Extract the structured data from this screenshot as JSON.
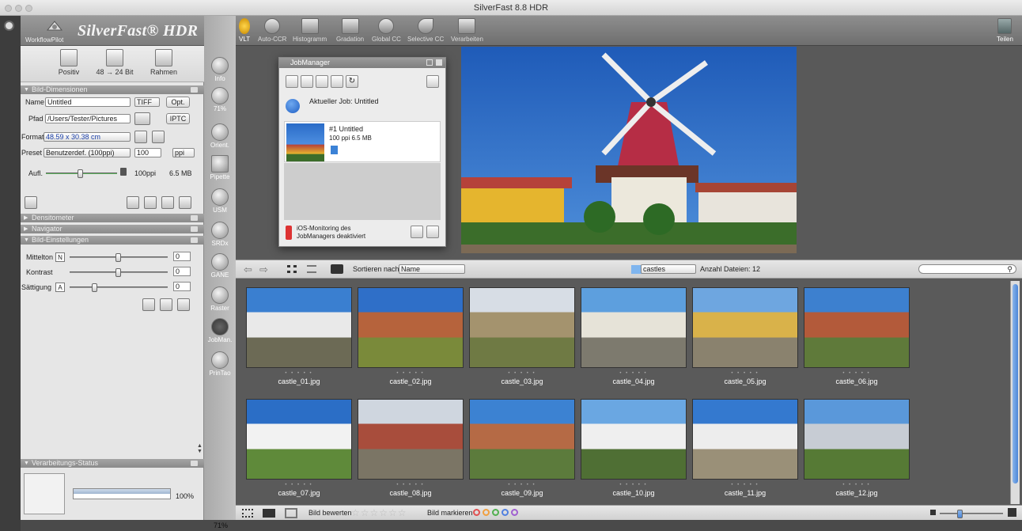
{
  "window": {
    "title": "SilverFast 8.8 HDR"
  },
  "logo": {
    "brand": "SilverFast® HDR",
    "workflowpilot": "WorkflowPilot"
  },
  "modes": [
    {
      "label": "Positiv"
    },
    {
      "label": "48 → 24 Bit"
    },
    {
      "label": "Rahmen"
    }
  ],
  "bild_dimensionen": {
    "header": "Bild-Dimensionen",
    "name_label": "Name",
    "name_value": "Untitled",
    "format_popup": "TIFF",
    "opt_button": "Opt.",
    "pfad_label": "Pfad",
    "pfad_value": "/Users/Tester/Pictures",
    "iptc_button": "IPTC",
    "format_label": "Format",
    "format_value": "48.59 x 30.38 cm",
    "preset_label": "Preset",
    "preset_value": "Benutzerdef. (100ppi)",
    "ppi_value": "100",
    "ppi_unit": "ppi",
    "aufl_label": "Aufl.",
    "aufl_value": "100ppi",
    "size_value": "6.5 MB"
  },
  "collapsed_sections": [
    "Densitometer",
    "Navigator"
  ],
  "bild_einstellungen": {
    "header": "Bild-Einstellungen",
    "rows": [
      {
        "label": "Mittelton",
        "letter": "N",
        "value": "0"
      },
      {
        "label": "Kontrast",
        "letter": "",
        "value": "0"
      },
      {
        "label": "Sättigung",
        "letter": "A",
        "value": "0"
      }
    ]
  },
  "verarbeitung": {
    "header": "Verarbeitungs-Status",
    "progress": "100%"
  },
  "tools": [
    {
      "label": "Info"
    },
    {
      "label": "71%"
    },
    {
      "label": "Orient."
    },
    {
      "label": "Pipette"
    },
    {
      "label": "USM"
    },
    {
      "label": "SRDx"
    },
    {
      "label": "GANE"
    },
    {
      "label": "Raster"
    },
    {
      "label": "JobMan."
    },
    {
      "label": "PrinTao"
    }
  ],
  "toolbar": [
    {
      "label": "VLT"
    },
    {
      "label": "Auto-CCR"
    },
    {
      "label": "Histogramm"
    },
    {
      "label": "Gradation"
    },
    {
      "label": "Global CC"
    },
    {
      "label": "Selective CC"
    },
    {
      "label": "Verarbeiten"
    }
  ],
  "teilen": "Teilen",
  "jobmanager": {
    "title": "JobManager",
    "current_job": "Aktueller Job: Untitled",
    "job_name": "#1 Untitled",
    "job_info": "100 ppi   6.5 MB",
    "ios_text_1": "iOS-Monitoring des",
    "ios_text_2": "JobManagers deaktiviert"
  },
  "browser": {
    "sort_label": "Sortieren nach",
    "sort_value": "Name",
    "folder": "castles",
    "count_label": "Anzahl Dateien: 12"
  },
  "thumbnails": [
    {
      "name": "castle_01.jpg",
      "sky": "#3a7fd0",
      "ground": "#6c6a55",
      "bldg": "#e9e9e9"
    },
    {
      "name": "castle_02.jpg",
      "sky": "#2f6fc8",
      "ground": "#7a8a3a",
      "bldg": "#b6633c"
    },
    {
      "name": "castle_03.jpg",
      "sky": "#d7dde5",
      "ground": "#6f7a44",
      "bldg": "#a4936e"
    },
    {
      "name": "castle_04.jpg",
      "sky": "#5d9fde",
      "ground": "#7d7a6e",
      "bldg": "#e6e3d8"
    },
    {
      "name": "castle_05.jpg",
      "sky": "#6ea6e0",
      "ground": "#8a826e",
      "bldg": "#d9b24a"
    },
    {
      "name": "castle_06.jpg",
      "sky": "#3d80cf",
      "ground": "#5f7a3a",
      "bldg": "#b35a3a"
    },
    {
      "name": "castle_07.jpg",
      "sky": "#2b6ec6",
      "ground": "#5f8a3a",
      "bldg": "#f2f2f2"
    },
    {
      "name": "castle_08.jpg",
      "sky": "#cfd6df",
      "ground": "#7b7565",
      "bldg": "#a84d3c"
    },
    {
      "name": "castle_09.jpg",
      "sky": "#3c82d2",
      "ground": "#5c7b3c",
      "bldg": "#b56a45"
    },
    {
      "name": "castle_10.jpg",
      "sky": "#6aa7e2",
      "ground": "#4f6f34",
      "bldg": "#efefef"
    },
    {
      "name": "castle_11.jpg",
      "sky": "#3479cf",
      "ground": "#9a9078",
      "bldg": "#ededed"
    },
    {
      "name": "castle_12.jpg",
      "sky": "#5a98da",
      "ground": "#567a35",
      "bldg": "#c7ccd4"
    }
  ],
  "bottom": {
    "rate_label": "Bild bewerten",
    "mark_label": "Bild markieren",
    "mark_colors": [
      "#e05050",
      "#f0a040",
      "#50b050",
      "#5080e0",
      "#a060d0"
    ]
  },
  "status": {
    "zoom": "71%"
  }
}
